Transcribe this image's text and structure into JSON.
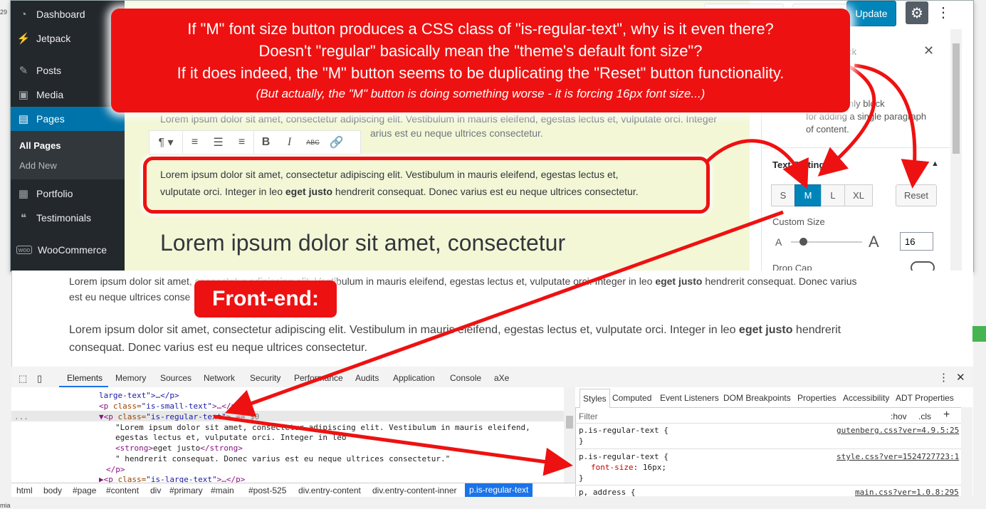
{
  "annotation": {
    "line1": "If \"M\" font size button produces a CSS class of \"is-regular-text\", why is it even there?",
    "line2": "Doesn't \"regular\" basically mean the \"theme's default font size\"?",
    "line3": "If it does indeed, the \"M\" button seems to be duplicating the \"Reset\" button functionality.",
    "line4": "(But actually, the \"M\" button is doing something worse - it is forcing 16px font size...)",
    "frontend_label": "Front-end:",
    "accent_color": "#ee1111"
  },
  "wp_sidebar": {
    "items": [
      {
        "label": "Dashboard",
        "icon": "dashboard-icon"
      },
      {
        "label": "Jetpack",
        "icon": "jetpack-icon"
      },
      {
        "label": "Posts",
        "icon": "pin-icon"
      },
      {
        "label": "Media",
        "icon": "media-icon"
      },
      {
        "label": "Pages",
        "icon": "pages-icon"
      },
      {
        "label": "Portfolio",
        "icon": "portfolio-icon"
      },
      {
        "label": "Testimonials",
        "icon": "testimonials-icon"
      },
      {
        "label": "WooCommerce",
        "icon": "woocommerce-icon"
      }
    ],
    "sub": [
      "All Pages",
      "Add New"
    ],
    "active_color": "#0073aa"
  },
  "topbar": {
    "update_label": "Update"
  },
  "editor": {
    "faded_para_line1": "Lorem ipsum dolor sit amet, consectetur adipiscing elit. Vestibulum in mauris eleifend, egestas lectus et, vulputate orci. Integer",
    "faded_para_line2": "arius est eu neque ultrices consectetur.",
    "para_line1": "Lorem ipsum dolor sit amet, consectetur adipiscing elit. Vestibulum in mauris eleifend, egestas lectus et,",
    "para_line2_a": "vulputate orci. Integer in leo ",
    "para_line2_bold": "eget justo",
    "para_line2_b": " hendrerit consequat. Donec varius est eu neque ultrices consectetur.",
    "heading": "Lorem ipsum dolor sit amet, consectetur"
  },
  "settings": {
    "block_suffix": "ck",
    "desc_line1": "nple text only block",
    "desc_line2": "for adding a single paragraph",
    "desc_line3": "of content.",
    "text_settings": "Text Settings",
    "sizes": [
      "S",
      "M",
      "L",
      "XL"
    ],
    "reset": "Reset",
    "custom_size_label": "Custom Size",
    "custom_size_value": "16",
    "drop_cap": "Drop Cap",
    "a_small": "A",
    "a_large": "A"
  },
  "frontend": {
    "small_line1_a": "Lorem ipsum dolor sit amet, consectetur adipiscing elit. Vestibulum in mauris eleifend, egestas lectus et, vulputate orci. Integer in leo ",
    "small_bold": "eget justo",
    "small_line1_b": " hendrerit consequat. Donec varius",
    "small_line2": "est eu neque ultrices conse",
    "regular_line1_a": "Lorem ipsum dolor sit amet, consectetur adipiscing elit. Vestibulum in mauris eleifend, egestas lectus et, vulputate orci. Integer in leo ",
    "regular_bold": "eget justo",
    "regular_line1_b": " hendrerit",
    "regular_line2": "consequat. Donec varius est eu neque ultrices consectetur."
  },
  "devtools": {
    "tabs": [
      "Elements",
      "Memory",
      "Sources",
      "Network",
      "Security",
      "Performance",
      "Audits",
      "Application",
      "Console",
      "aXe"
    ],
    "dom": {
      "line0": "large-text\">…</p>",
      "line1_tag": "<p ",
      "line1_attr": "class=",
      "line1_val": "\"is-small-text\"",
      "line1_end": ">…</p>",
      "line2_tag": "▼<p ",
      "line2_attr": "class=",
      "line2_val": "\"is-regular-text\"",
      "line2_end": "> == $0",
      "line3": "\"Lorem ipsum dolor sit amet, consectetur adipiscing elit. Vestibulum in mauris eleifend,",
      "line4": "egestas lectus et, vulputate orci. Integer in leo \"",
      "line5_open": "<strong>",
      "line5_text": "eget justo",
      "line5_close": "</strong>",
      "line6": "\" hendrerit consequat. Donec varius est eu neque ultrices consectetur.\"",
      "line7": "</p>",
      "line8_tag": "▶<p ",
      "line8_attr": "class=",
      "line8_val": "\"is-large-text\"",
      "line8_end": ">…</p>",
      "ellipsis": "..."
    },
    "breadcrumbs": [
      "html",
      "body",
      "#page",
      "#content",
      "div",
      "#primary",
      "#main",
      "#post-525",
      "div.entry-content",
      "div.entry-content-inner",
      "p.is-regular-text"
    ],
    "styles_tabs": [
      "Styles",
      "Computed",
      "Event Listeners",
      "DOM Breakpoints",
      "Properties",
      "Accessibility",
      "ADT Properties"
    ],
    "filter_placeholder": "Filter",
    "hov": ":hov",
    "cls": ".cls",
    "rule1_selector": "p.is-regular-text {",
    "rule1_source": "gutenberg.css?ver=4.9.5:25",
    "rule1_close": "}",
    "rule2_selector": "p.is-regular-text {",
    "rule2_source": "style.css?ver=1524727723:1",
    "rule2_prop": "font-size",
    "rule2_value": ": 16px;",
    "rule2_close": "}",
    "rule3_selector": "p, address {",
    "rule3_source": "main.css?ver=1.0.8:295"
  }
}
